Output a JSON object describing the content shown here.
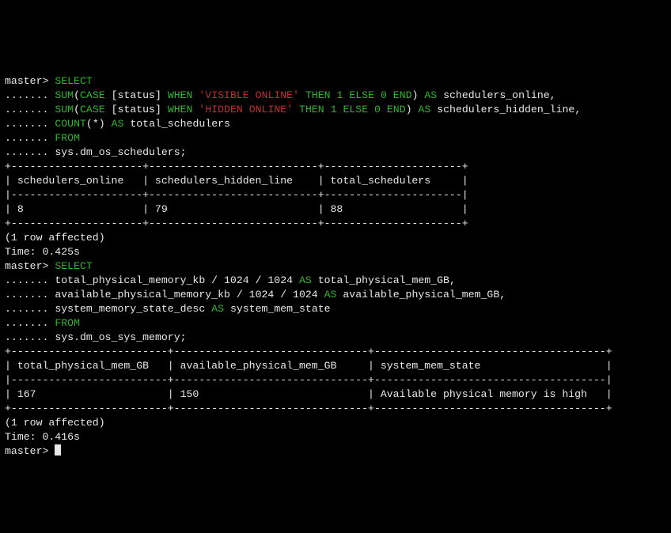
{
  "prompt_db": "master",
  "continuation_dots": ".......",
  "kw": {
    "select": "SELECT",
    "sum": "SUM",
    "case": "CASE",
    "when": "WHEN",
    "then": "THEN",
    "else": "ELSE",
    "end": "END",
    "as": "AS",
    "count": "COUNT",
    "from": "FROM"
  },
  "q1": {
    "status_col": "[status]",
    "lit_visible": "'VISIBLE ONLINE'",
    "lit_hidden": "'HIDDEN ONLINE'",
    "one": "1",
    "zero": "0",
    "star": "*",
    "alias_online": "schedulers_online",
    "alias_hidden": "schedulers_hidden_line",
    "alias_total": "total_schedulers",
    "table": "sys.dm_os_schedulers;"
  },
  "q1_result": {
    "border_top": "+---------------------+---------------------------+----------------------+",
    "header_row": "| schedulers_online   | schedulers_hidden_line    | total_schedulers     |",
    "sep_row": "|---------------------+---------------------------+----------------------|",
    "data_row": "| 8                   | 79                        | 88                   |",
    "border_bot": "+---------------------+---------------------------+----------------------+",
    "affected": "(1 row affected)",
    "time": "Time: 0.425s",
    "cols": [
      "schedulers_online",
      "schedulers_hidden_line",
      "total_schedulers"
    ],
    "values": {
      "schedulers_online": 8,
      "schedulers_hidden_line": 79,
      "total_schedulers": 88
    }
  },
  "q2": {
    "expr_total": "total_physical_memory_kb / 1024 / 1024",
    "alias_total": "total_physical_mem_GB",
    "expr_avail": "available_physical_memory_kb / 1024 / 1024",
    "alias_avail": "available_physical_mem_GB",
    "expr_state": "system_memory_state_desc",
    "alias_state": "system_mem_state",
    "table": "sys.dm_os_sys_memory;"
  },
  "q2_result": {
    "border_top": "+-------------------------+-------------------------------+-------------------------------------+",
    "header_row": "| total_physical_mem_GB   | available_physical_mem_GB     | system_mem_state                    |",
    "sep_row": "|-------------------------+-------------------------------+-------------------------------------|",
    "data_row": "| 167                     | 150                           | Available physical memory is high   |",
    "border_bot": "+-------------------------+-------------------------------+-------------------------------------+",
    "affected": "(1 row affected)",
    "time": "Time: 0.416s",
    "cols": [
      "total_physical_mem_GB",
      "available_physical_mem_GB",
      "system_mem_state"
    ],
    "values": {
      "total_physical_mem_GB": 167,
      "available_physical_mem_GB": 150,
      "system_mem_state": "Available physical memory is high"
    }
  }
}
